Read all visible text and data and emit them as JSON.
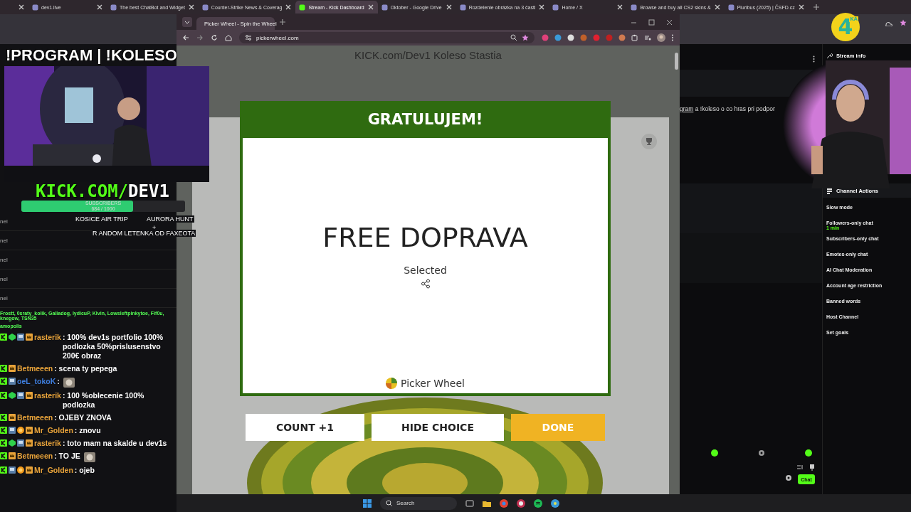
{
  "outer_tabs": [
    {
      "selected": false
    },
    {
      "title": "dev1.live",
      "selected": false
    },
    {
      "title": "The best ChatBot and Widget",
      "selected": false
    },
    {
      "title": "Counter-Strike News & Coverag",
      "selected": false
    },
    {
      "title": "Stream - Kick Dashboard",
      "selected": true
    },
    {
      "title": "Oktober - Google Drive",
      "selected": false
    },
    {
      "title": "Rozdelenie obrázka na 3 časti",
      "selected": false
    },
    {
      "title": "Home / X",
      "selected": false
    },
    {
      "title": "Browse and buy all CS2 skins &",
      "selected": false
    },
    {
      "title": "Pluribus (2025) | ČSFD.cz",
      "selected": false
    }
  ],
  "overlay": {
    "title": "!PROGRAM | !KOLESO",
    "logo": {
      "green": "KICK.COM/",
      "white": "DEV1"
    },
    "subscribers": {
      "label": "SUBSCRIBERS",
      "count": "684 / 1000",
      "level": 0.684
    },
    "goals": [
      "KOSICE AIR TRIP",
      "AURORA HUNT",
      "+",
      "R ANDOM LETENKA OD FAXEOTA"
    ],
    "channel_rows": [
      "nel",
      "nel",
      "nel",
      "nel",
      "nel"
    ],
    "supporters": [
      "Frostt, 0sraty_kolik, Galladog, lydicuP, Klvin, Lowsleftpinkytoe, Fif0u, knegow, TSN35",
      "amopolis"
    ],
    "chat": [
      {
        "user": "rasterik",
        "color": "#e8a33a",
        "badges": [
          {
            "kind": "kick"
          },
          {
            "kind": "gem"
          },
          {
            "kind": "vip"
          },
          {
            "kind": "crown"
          }
        ],
        "text": ": 100% dev1s portfolio 100% podlozka 50%prislusenstvo 200€ obraz"
      },
      {
        "user": "Betmeeen",
        "color": "#e8a33a",
        "badges": [
          {
            "kind": "kick"
          },
          {
            "kind": "crown"
          }
        ],
        "text": ": scena ty pepega"
      },
      {
        "user": "oeL_tokoK",
        "color": "#3f7fe0",
        "badges": [
          {
            "kind": "kick"
          },
          {
            "kind": "vip"
          }
        ],
        "text": ":",
        "emote": true
      },
      {
        "user": "rasterik",
        "color": "#e8a33a",
        "badges": [
          {
            "kind": "kick"
          },
          {
            "kind": "gem"
          },
          {
            "kind": "vip"
          },
          {
            "kind": "crown"
          }
        ],
        "text": ": 100 %oblecenie 100% podlozka"
      },
      {
        "user": "Betmeeen",
        "color": "#e8a33a",
        "badges": [
          {
            "kind": "kick"
          },
          {
            "kind": "crown"
          }
        ],
        "text": ": OJEBY ZNOVA"
      },
      {
        "user": "Mr_Golden",
        "color": "#e8a33a",
        "badges": [
          {
            "kind": "kick"
          },
          {
            "kind": "vip"
          },
          {
            "kind": "coin"
          },
          {
            "kind": "crown"
          }
        ],
        "text": ": znovu"
      },
      {
        "user": "rasterik",
        "color": "#e8a33a",
        "badges": [
          {
            "kind": "kick"
          },
          {
            "kind": "gem"
          },
          {
            "kind": "vip"
          },
          {
            "kind": "crown"
          }
        ],
        "text": ": toto mam na skalde u dev1s"
      },
      {
        "user": "Betmeeen",
        "color": "#e8a33a",
        "badges": [
          {
            "kind": "kick"
          },
          {
            "kind": "crown"
          }
        ],
        "text": ": TO JE",
        "emote": true
      },
      {
        "user": "Mr_Golden",
        "color": "#e8a33a",
        "badges": [
          {
            "kind": "kick"
          },
          {
            "kind": "vip"
          },
          {
            "kind": "coin"
          },
          {
            "kind": "crown"
          }
        ],
        "text": ": ojeb"
      }
    ]
  },
  "browser": {
    "tab": "Picker Wheel - Spin the Wheel",
    "url": "pickerwheel.com",
    "page_title": "KICK.com/Dev1 Koleso Stastia",
    "modal": {
      "heading": "GRATULUJEM!",
      "result": "FREE DOPRAVA",
      "caption": "Selected",
      "brand": "Picker Wheel"
    },
    "buttons": [
      {
        "label": "COUNT +1",
        "kind": "plain"
      },
      {
        "label": "HIDE CHOICE",
        "kind": "plain"
      },
      {
        "label": "DONE",
        "kind": "primary"
      }
    ]
  },
  "dashboard": {
    "chat_line": {
      "link": "gram",
      "text": "a !koleso o co hras pri podpor"
    },
    "stream_info": "Stream info",
    "channel_actions": {
      "title": "Channel Actions",
      "items": [
        {
          "label": "Slow mode"
        },
        {
          "label": "Followers-only chat",
          "detail": "1 min"
        },
        {
          "label": "Subscribers-only chat"
        },
        {
          "label": "Emotes-only chat"
        },
        {
          "label": "AI Chat Moderation"
        },
        {
          "label": "Account age restriction"
        },
        {
          "label": "Banned words"
        },
        {
          "label": "Host Channel"
        },
        {
          "label": "Set goals"
        }
      ]
    },
    "chat_button": "Chat"
  },
  "corner_logo": {
    "digit": "4",
    "text": "KA"
  },
  "taskbar": {
    "search": "Search"
  }
}
